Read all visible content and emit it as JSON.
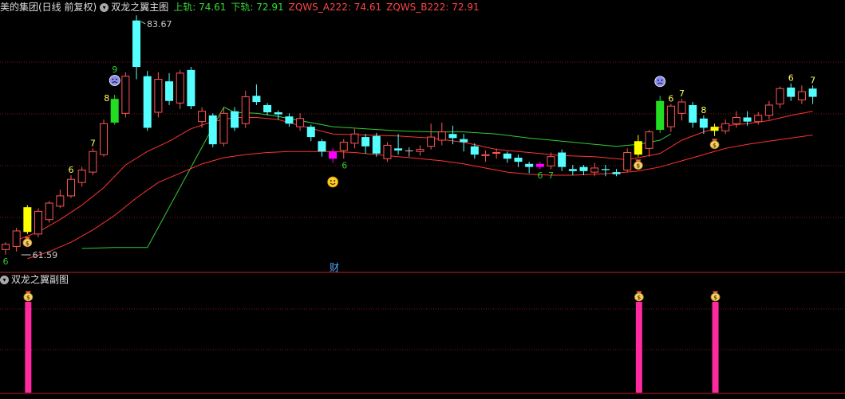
{
  "header": {
    "stock": "美的集团(日线 前复权)",
    "indicator_name": "双龙之翼主图",
    "upper_label": "上轨: ",
    "upper_value": "74.61",
    "lower_label": "下轨: ",
    "lower_value": "72.91",
    "a_label": "ZQWS_A222: ",
    "a_value": "74.61",
    "b_label": "ZQWS_B222: ",
    "b_value": "72.91"
  },
  "sub_header": {
    "indicator_name": "双龙之翼副图"
  },
  "cai_label": "财",
  "colors": {
    "up": "#ff5555",
    "down": "#55ffff",
    "green_line": "#33cc33",
    "red_line": "#ff3333",
    "grid": "#7a1a1a",
    "white": "#cfcfcf",
    "signal_bar": "#ff2aa0"
  },
  "chart_data": {
    "type": "candlestick",
    "price_range": [
      58,
      88
    ],
    "high_annotation": "83.67",
    "low_annotation": "61.59",
    "candles": [
      [
        61.8,
        62.3,
        61.3,
        62.5,
        "r"
      ],
      [
        62.1,
        63.6,
        61.6,
        63.9,
        "r"
      ],
      [
        63.5,
        65.9,
        63.3,
        66.1,
        "Y"
      ],
      [
        63.3,
        65.5,
        63.0,
        65.8,
        "r"
      ],
      [
        64.7,
        66.3,
        64.4,
        66.5,
        "r"
      ],
      [
        66.0,
        67.0,
        65.8,
        67.6,
        "r"
      ],
      [
        67.0,
        68.6,
        66.8,
        69.0,
        "r"
      ],
      [
        68.3,
        69.5,
        67.9,
        69.8,
        "r"
      ],
      [
        69.3,
        71.3,
        69.0,
        71.6,
        "r"
      ],
      [
        71.0,
        74.0,
        70.8,
        74.4,
        "r"
      ],
      [
        74.1,
        76.4,
        73.9,
        76.8,
        "G"
      ],
      [
        75.0,
        78.6,
        74.6,
        79.0,
        "r"
      ],
      [
        84.0,
        79.5,
        78.3,
        84.5,
        "c"
      ],
      [
        78.6,
        73.6,
        73.3,
        79.1,
        "c"
      ],
      [
        75.1,
        78.3,
        74.6,
        79.0,
        "r"
      ],
      [
        78.1,
        76.2,
        75.8,
        78.9,
        "c"
      ],
      [
        76.0,
        78.9,
        75.4,
        79.2,
        "r"
      ],
      [
        79.2,
        75.7,
        75.4,
        79.5,
        "c"
      ],
      [
        75.2,
        74.2,
        73.6,
        75.6,
        "r"
      ],
      [
        74.8,
        72.0,
        71.7,
        75.0,
        "c"
      ],
      [
        72.1,
        75.0,
        71.8,
        75.5,
        "r"
      ],
      [
        75.2,
        73.6,
        73.3,
        75.6,
        "c"
      ],
      [
        74.0,
        76.6,
        73.6,
        77.2,
        "r"
      ],
      [
        76.7,
        76.1,
        75.8,
        77.8,
        "c"
      ],
      [
        75.8,
        75.1,
        74.8,
        76.0,
        "c"
      ],
      [
        75.1,
        74.9,
        74.4,
        75.3,
        "c"
      ],
      [
        74.7,
        74.0,
        73.7,
        75.0,
        "c"
      ],
      [
        73.7,
        74.5,
        73.3,
        75.0,
        "r"
      ],
      [
        73.7,
        72.7,
        72.3,
        73.9,
        "c"
      ],
      [
        72.3,
        71.3,
        70.8,
        72.5,
        "c"
      ],
      [
        70.6,
        71.3,
        70.2,
        71.6,
        "M"
      ],
      [
        71.4,
        72.2,
        70.6,
        72.5,
        "r"
      ],
      [
        72.1,
        73.0,
        71.6,
        73.5,
        "r"
      ],
      [
        72.7,
        71.8,
        71.1,
        73.0,
        "c"
      ],
      [
        72.8,
        71.1,
        70.8,
        73.1,
        "c"
      ],
      [
        70.6,
        71.9,
        70.3,
        72.2,
        "r"
      ],
      [
        71.4,
        71.6,
        71.0,
        73.0,
        "c"
      ],
      [
        71.4,
        71.4,
        70.8,
        71.7,
        "w"
      ],
      [
        71.3,
        71.5,
        70.9,
        71.9,
        "r"
      ],
      [
        71.8,
        72.7,
        71.5,
        74.0,
        "r"
      ],
      [
        72.4,
        73.2,
        71.9,
        74.1,
        "r"
      ],
      [
        73.0,
        72.6,
        72.0,
        73.8,
        "c"
      ],
      [
        72.5,
        72.2,
        71.3,
        73.0,
        "c"
      ],
      [
        71.8,
        71.0,
        70.6,
        72.1,
        "c"
      ],
      [
        70.9,
        71.0,
        70.3,
        71.4,
        "r"
      ],
      [
        71.2,
        71.2,
        70.6,
        71.6,
        "r"
      ],
      [
        71.1,
        70.6,
        70.2,
        71.3,
        "c"
      ],
      [
        70.7,
        70.3,
        69.8,
        71.0,
        "c"
      ],
      [
        70.1,
        69.8,
        69.2,
        70.3,
        "c"
      ],
      [
        69.8,
        70.1,
        69.6,
        70.3,
        "M"
      ],
      [
        69.9,
        70.8,
        69.6,
        71.2,
        "r"
      ],
      [
        71.2,
        69.8,
        69.4,
        71.5,
        "c"
      ],
      [
        69.4,
        69.6,
        69.0,
        70.0,
        "c"
      ],
      [
        69.8,
        69.4,
        69.0,
        70.0,
        "c"
      ],
      [
        69.3,
        69.7,
        68.9,
        70.2,
        "r"
      ],
      [
        69.6,
        69.5,
        68.9,
        70.0,
        "c"
      ],
      [
        69.1,
        69.3,
        68.9,
        69.6,
        "c"
      ],
      [
        69.5,
        71.2,
        69.3,
        71.6,
        "r"
      ],
      [
        71.0,
        72.3,
        70.8,
        72.9,
        "Y"
      ],
      [
        71.6,
        73.2,
        70.8,
        73.4,
        "r"
      ],
      [
        76.2,
        73.4,
        73.1,
        76.7,
        "G"
      ],
      [
        73.7,
        75.7,
        73.2,
        75.9,
        "r"
      ],
      [
        75.0,
        76.1,
        74.3,
        76.4,
        "r"
      ],
      [
        75.8,
        74.1,
        73.6,
        76.1,
        "c"
      ],
      [
        74.5,
        73.6,
        73.0,
        74.8,
        "c"
      ],
      [
        73.7,
        73.3,
        72.8,
        74.0,
        "Y"
      ],
      [
        73.3,
        74.0,
        73.0,
        74.4,
        "r"
      ],
      [
        74.0,
        74.6,
        73.6,
        75.2,
        "r"
      ],
      [
        74.6,
        74.2,
        73.8,
        75.2,
        "c"
      ],
      [
        74.2,
        74.8,
        73.9,
        75.1,
        "r"
      ],
      [
        74.8,
        75.8,
        74.4,
        76.2,
        "r"
      ],
      [
        75.9,
        77.4,
        75.5,
        77.6,
        "r"
      ],
      [
        77.5,
        76.6,
        76.2,
        77.9,
        "c"
      ],
      [
        76.3,
        77.1,
        75.9,
        77.7,
        "r"
      ],
      [
        77.4,
        76.6,
        75.9,
        77.7,
        "c"
      ]
    ],
    "green_line": [
      [
        7,
        61.9
      ],
      [
        10,
        62.0
      ],
      [
        13,
        62.0
      ],
      [
        20,
        75.6
      ],
      [
        21,
        75.1
      ],
      [
        23,
        75.0
      ],
      [
        25,
        74.7
      ],
      [
        27,
        74.3
      ],
      [
        30,
        73.7
      ],
      [
        33,
        73.5
      ],
      [
        36,
        73.3
      ],
      [
        39,
        73.2
      ],
      [
        42,
        73.2
      ],
      [
        45,
        73.0
      ],
      [
        48,
        72.6
      ],
      [
        51,
        72.3
      ],
      [
        54,
        72.0
      ],
      [
        56,
        71.8
      ],
      [
        58,
        72.0
      ],
      [
        60,
        72.4
      ],
      [
        61,
        73.0
      ]
    ],
    "red_line_upper": [
      [
        1,
        62.7
      ],
      [
        3,
        63.5
      ],
      [
        5,
        64.7
      ],
      [
        7,
        66.1
      ],
      [
        9,
        67.8
      ],
      [
        11,
        70.0
      ],
      [
        13,
        71.3
      ],
      [
        15,
        72.3
      ],
      [
        17,
        73.5
      ],
      [
        19,
        74.2
      ],
      [
        21,
        74.6
      ],
      [
        23,
        74.6
      ],
      [
        25,
        74.4
      ],
      [
        27,
        73.8
      ],
      [
        30,
        73.0
      ],
      [
        33,
        72.9
      ],
      [
        36,
        72.8
      ],
      [
        39,
        72.6
      ],
      [
        42,
        72.2
      ],
      [
        45,
        71.5
      ],
      [
        48,
        71.2
      ],
      [
        51,
        70.9
      ],
      [
        54,
        70.8
      ],
      [
        57,
        70.5
      ],
      [
        60,
        71.1
      ],
      [
        62,
        72.4
      ],
      [
        64,
        73.2
      ],
      [
        66,
        73.8
      ],
      [
        68,
        74.0
      ],
      [
        70,
        74.3
      ],
      [
        72,
        74.8
      ],
      [
        74,
        75.2
      ]
    ],
    "red_line_lower": [
      [
        2,
        60.9
      ],
      [
        4,
        61.6
      ],
      [
        6,
        62.5
      ],
      [
        8,
        63.7
      ],
      [
        10,
        65.1
      ],
      [
        12,
        66.8
      ],
      [
        14,
        68.3
      ],
      [
        16,
        69.2
      ],
      [
        18,
        70.1
      ],
      [
        20,
        70.7
      ],
      [
        22,
        71.0
      ],
      [
        24,
        71.2
      ],
      [
        26,
        71.3
      ],
      [
        28,
        71.3
      ],
      [
        30,
        71.3
      ],
      [
        32,
        71.2
      ],
      [
        34,
        71.0
      ],
      [
        36,
        70.8
      ],
      [
        38,
        70.6
      ],
      [
        40,
        70.4
      ],
      [
        42,
        70.1
      ],
      [
        44,
        69.7
      ],
      [
        46,
        69.3
      ],
      [
        48,
        69.1
      ],
      [
        50,
        69.0
      ],
      [
        52,
        69.0
      ],
      [
        54,
        69.1
      ],
      [
        56,
        69.2
      ],
      [
        58,
        69.4
      ],
      [
        60,
        69.8
      ],
      [
        62,
        70.4
      ],
      [
        64,
        71.0
      ],
      [
        66,
        71.6
      ],
      [
        68,
        72.0
      ],
      [
        70,
        72.3
      ],
      [
        72,
        72.6
      ],
      [
        74,
        72.9
      ]
    ],
    "labels": [
      {
        "i": 0,
        "text": "6",
        "pos": "below",
        "color": "#33cc33"
      },
      {
        "i": 6,
        "text": "6",
        "pos": "above",
        "color": "#ffff55"
      },
      {
        "i": 8,
        "text": "7",
        "pos": "above",
        "color": "#ffff55"
      },
      {
        "i": 10,
        "text": "8",
        "pos": "left",
        "color": "#ffff55"
      },
      {
        "i": 10,
        "text": "9",
        "pos": "above2",
        "color": "#33cc33"
      },
      {
        "i": 31,
        "text": "6",
        "pos": "left_low",
        "color": "#33cc33"
      },
      {
        "i": 49,
        "text": "6",
        "pos": "below",
        "color": "#33cc33"
      },
      {
        "i": 50,
        "text": "7",
        "pos": "below",
        "color": "#33cc33"
      },
      {
        "i": 61,
        "text": "6",
        "pos": "above",
        "color": "#ffff55"
      },
      {
        "i": 62,
        "text": "7",
        "pos": "above",
        "color": "#ffff55"
      },
      {
        "i": 64,
        "text": "8",
        "pos": "above",
        "color": "#ffff55"
      },
      {
        "i": 72,
        "text": "6",
        "pos": "above",
        "color": "#ffff55"
      },
      {
        "i": 74,
        "text": "7",
        "pos": "above",
        "color": "#ffff55"
      }
    ],
    "icons": [
      {
        "i": 2,
        "kind": "money-bag",
        "pos": "below"
      },
      {
        "i": 10,
        "kind": "sad-face",
        "pos": "top"
      },
      {
        "i": 30,
        "kind": "smiley",
        "pos": "below"
      },
      {
        "i": 58,
        "kind": "money-bag",
        "pos": "below"
      },
      {
        "i": 60,
        "kind": "sad-face",
        "pos": "top"
      },
      {
        "i": 65,
        "kind": "money-bag",
        "pos": "below"
      }
    ],
    "signal_bars": [
      2,
      58,
      65
    ]
  }
}
